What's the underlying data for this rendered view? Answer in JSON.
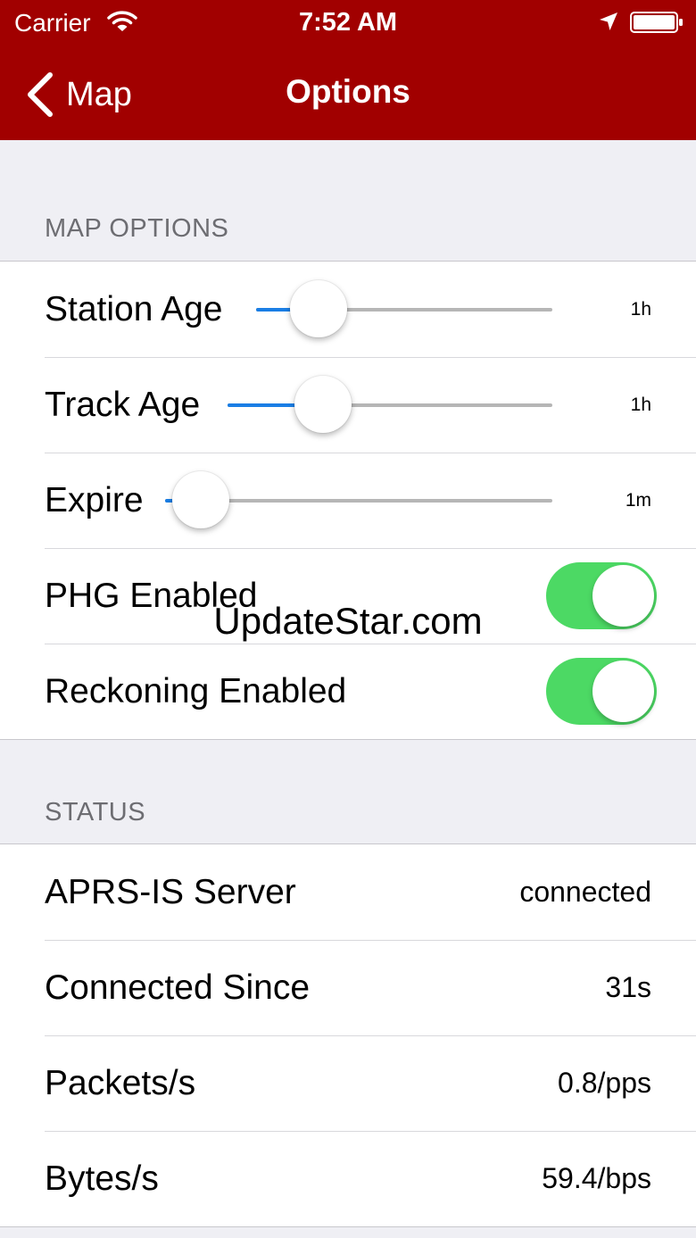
{
  "status_bar": {
    "carrier": "Carrier",
    "time": "7:52 AM",
    "icons": [
      "wifi-icon",
      "location-arrow-icon",
      "battery-icon"
    ]
  },
  "nav": {
    "back_label": "Map",
    "title": "Options",
    "background_color": "#a10000"
  },
  "map_options": {
    "header": "MAP OPTIONS",
    "station_age": {
      "label": "Station Age",
      "value": "1h",
      "slider_fraction": 0.21
    },
    "track_age": {
      "label": "Track Age",
      "value": "1h",
      "slider_fraction": 0.22
    },
    "expire": {
      "label": "Expire",
      "value": "1m",
      "slider_fraction": 0.0
    },
    "phg_enabled": {
      "label": "PHG Enabled",
      "on": true
    },
    "reckoning_enabled": {
      "label": "Reckoning Enabled",
      "on": true
    }
  },
  "status": {
    "header": "STATUS",
    "rows": [
      {
        "label": "APRS-IS Server",
        "value": "connected"
      },
      {
        "label": "Connected Since",
        "value": "31s"
      },
      {
        "label": "Packets/s",
        "value": "0.8/pps"
      },
      {
        "label": "Bytes/s",
        "value": "59.4/bps"
      }
    ]
  },
  "colors": {
    "slider_fill": "#1a7ee5",
    "toggle_on": "#4cd964"
  },
  "watermark": "UpdateStar.com"
}
